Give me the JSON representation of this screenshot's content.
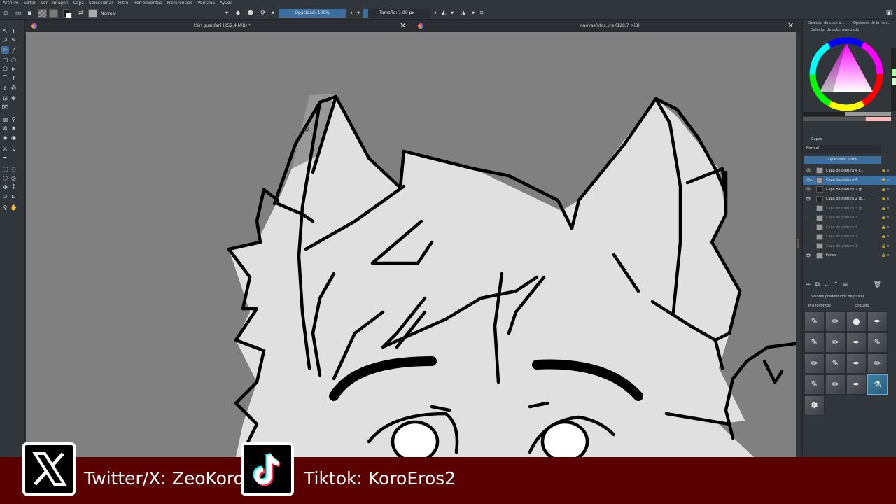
{
  "menu": [
    "Archivo",
    "Editar",
    "Ver",
    "Imagen",
    "Capa",
    "Seleccionar",
    "Filtro",
    "Herramientas",
    "Preferencias",
    "Ventana",
    "Ayuda"
  ],
  "toolbar": {
    "blend_mode": "Normal",
    "opacity_label": "Opacidad: 100%",
    "size_label": "Tamaño: 1.00 px"
  },
  "tabs": [
    {
      "title": "[Sin guardar] (252,4 MiB) *"
    },
    {
      "title": "nuevasfotos.kra (128,7 MiB)"
    }
  ],
  "dockers": {
    "top_tab_1": "Selector de color a...",
    "top_tab_2": "Opciones de la herr...",
    "color_selector_title": "Selector de color avanzado",
    "layers_title": "Capas",
    "layers_blend": "Normal",
    "layers_opacity": "Opacidad: 100%",
    "brushes_title": "Valores predefinidos de pincel",
    "brushes_filter": "Mis favoritos",
    "brushes_tag": "Etiqueta"
  },
  "layers": [
    {
      "name": "Capa de pintura 4 F...",
      "visible": true,
      "selected": false
    },
    {
      "name": "Capa de pintura 4",
      "visible": true,
      "selected": true
    },
    {
      "name": "Capa de pintura 2 (p...",
      "visible": true,
      "selected": false
    },
    {
      "name": "Capa de pintura 2 (p...",
      "visible": true,
      "selected": false
    },
    {
      "name": "Capa de pintura 3 (p...",
      "visible": false,
      "selected": false
    },
    {
      "name": "Capa de pintura 3",
      "visible": false,
      "selected": false
    },
    {
      "name": "Capa de pintura 2",
      "visible": false,
      "selected": false
    },
    {
      "name": "Capa de pintura 1",
      "visible": false,
      "selected": false
    },
    {
      "name": "Capa de pintura 1",
      "visible": false,
      "selected": false
    },
    {
      "name": "Fondo",
      "visible": true,
      "selected": false
    }
  ],
  "social": {
    "twitter": "Twitter/X: ZeoKoro",
    "tiktok": "Tiktok: KoroEros2"
  },
  "colors": {
    "accent": "#3b6fa0",
    "banner": "#5a0000",
    "canvas_bg": "#808080",
    "lineart_fill": "#e0e0e0"
  }
}
